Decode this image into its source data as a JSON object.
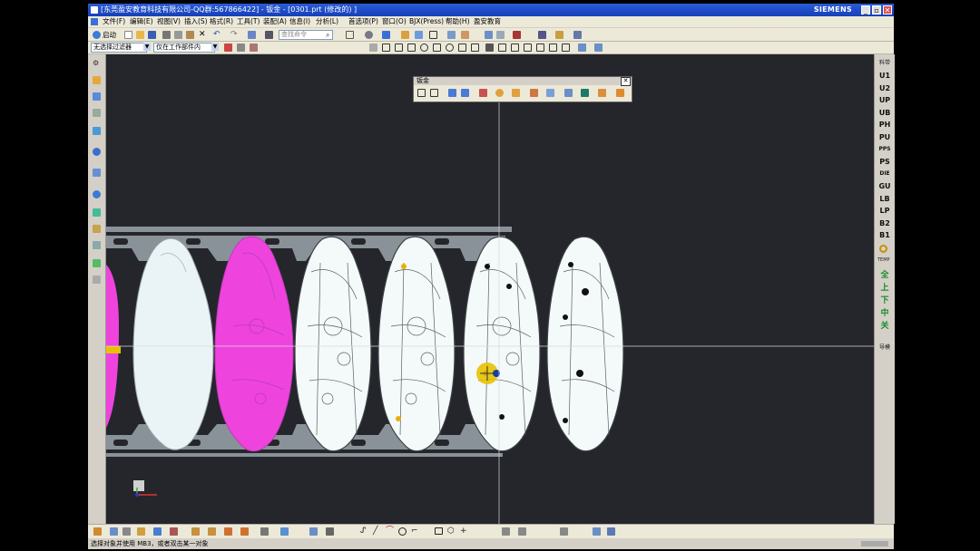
{
  "window": {
    "title": "[东莞盈安教育科技有限公司-QQ群:567866422] - 钣金 - [0301.prt (修改的) ]",
    "brand": "SIEMENS"
  },
  "menu": [
    "文件(F)",
    "编辑(E)",
    "视图(V)",
    "插入(S)",
    "格式(R)",
    "工具(T)",
    "装配(A)",
    "信息(I)",
    "分析(L)",
    "首选项(P)",
    "窗口(O)",
    "BJX(Press)",
    "帮助(H)",
    "盈安教育"
  ],
  "toolbar": {
    "start_label": "启动",
    "search_placeholder": "查找命令",
    "filter_value": "无选择过滤器",
    "scope_value": "仅在工作部件内"
  },
  "floating_toolbar": {
    "title": "钣金"
  },
  "right_palette": {
    "header": "料带",
    "items": [
      "U1",
      "U2",
      "UP",
      "UB",
      "PH",
      "PU",
      "PPS",
      "PS",
      "DIE",
      "GU",
      "LB",
      "LP",
      "B2",
      "B1"
    ],
    "cn_items": [
      "全",
      "上",
      "下",
      "中",
      "关"
    ],
    "footer": "导模"
  },
  "status": {
    "prompt": "选择对象并使用 MB3，或者双击某一对象"
  },
  "colors": {
    "canvas": "#25262b",
    "strip": "#8c949c",
    "highlight": "#ee44dd",
    "part": "#eef6f7",
    "titlebar": "#1f4ecc"
  }
}
